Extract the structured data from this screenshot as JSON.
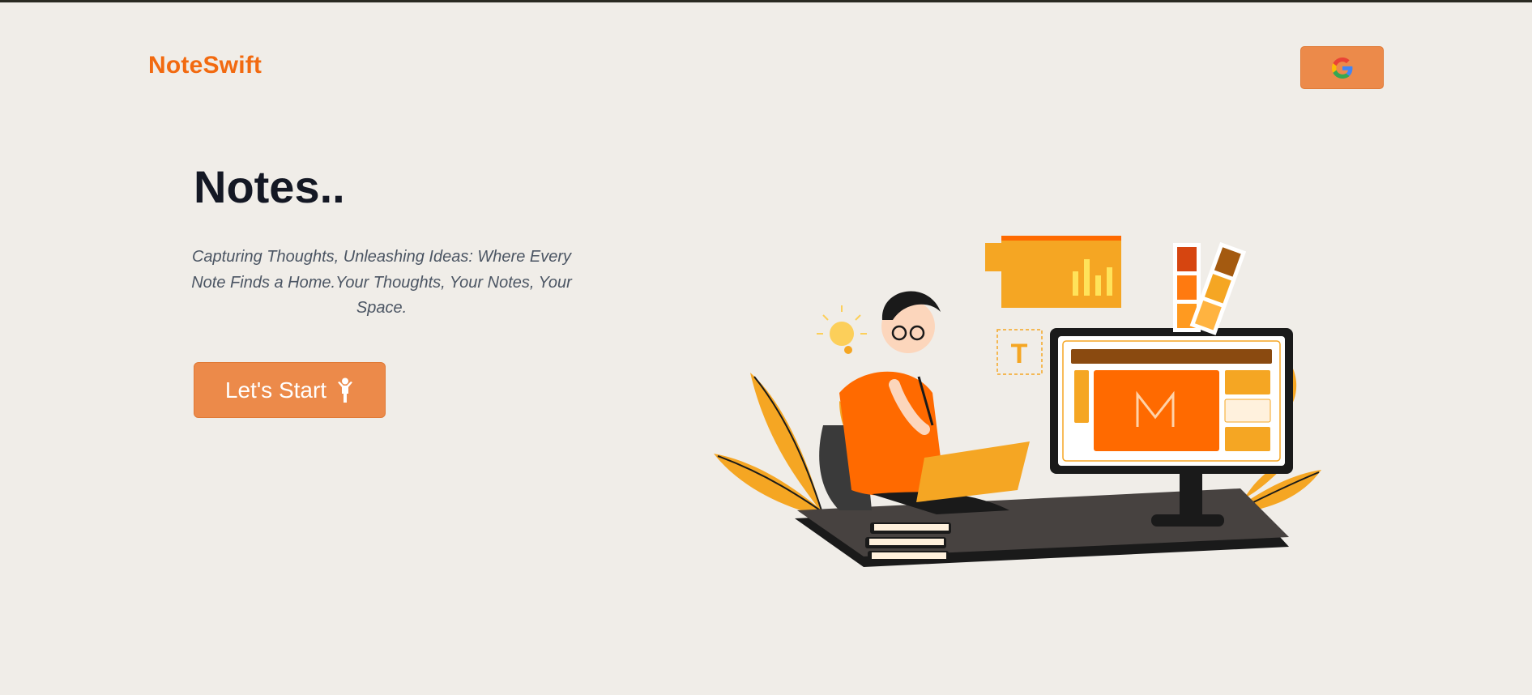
{
  "header": {
    "logo_text": "NoteSwift",
    "login_button_icon": "google-icon"
  },
  "hero": {
    "title": "Notes..",
    "tagline": "Capturing Thoughts, Unleashing Ideas: Where Every Note Finds a Home.Your Thoughts, Your Notes, Your Space.",
    "cta_label": "Let's Start",
    "cta_icon": "person-icon"
  },
  "illustration": {
    "icon": "person-at-desk-illustration",
    "chart_icon": "bar-chart-window-icon",
    "text_tool_label": "T",
    "lightbulb_icon": "lightbulb-icon"
  },
  "colors": {
    "background": "#f0ede8",
    "brand": "#f26a10",
    "button": "#ec8a4a",
    "heading": "#141824",
    "body_text": "#4b5563"
  }
}
